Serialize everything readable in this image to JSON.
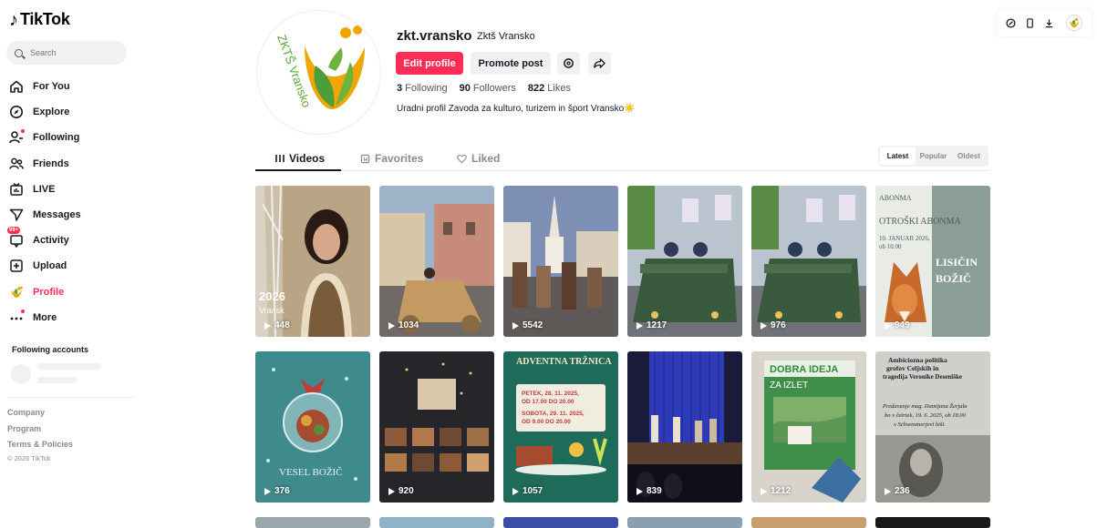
{
  "app": {
    "logo_text": "TikTok"
  },
  "search": {
    "placeholder": "Search"
  },
  "nav": [
    {
      "label": "For You",
      "icon": "home-icon"
    },
    {
      "label": "Explore",
      "icon": "compass-icon"
    },
    {
      "label": "Following",
      "icon": "following-icon"
    },
    {
      "label": "Friends",
      "icon": "friends-icon"
    },
    {
      "label": "LIVE",
      "icon": "live-icon"
    },
    {
      "label": "Messages",
      "icon": "messages-icon"
    },
    {
      "label": "Activity",
      "icon": "activity-icon",
      "badge": "99+"
    },
    {
      "label": "Upload",
      "icon": "upload-icon"
    },
    {
      "label": "Profile",
      "icon": "profile-icon",
      "active": true
    },
    {
      "label": "More",
      "icon": "more-icon"
    }
  ],
  "following_accounts": {
    "title": "Following accounts"
  },
  "footer": {
    "company": "Company",
    "program": "Program",
    "terms": "Terms & Policies",
    "copyright": "© 2026 TikTok"
  },
  "profile": {
    "username": "zkt.vransko",
    "nickname": "Zktš Vransko",
    "avatar_text": "ZKTŠ Vransko",
    "edit_label": "Edit profile",
    "promote_label": "Promote post",
    "stats": {
      "following_count": "3",
      "following_label": "Following",
      "followers_count": "90",
      "followers_label": "Followers",
      "likes_count": "822",
      "likes_label": "Likes"
    },
    "bio": "Uradni profil Zavoda za kulturo, turizem in šport Vransko☀️"
  },
  "tabs": {
    "videos": "Videos",
    "favorites": "Favorites",
    "liked": "Liked"
  },
  "sort": {
    "latest": "Latest",
    "popular": "Popular",
    "oldest": "Oldest"
  },
  "videos": [
    {
      "views": "448",
      "theme": "woman-speaking",
      "overlay": "2026\nVransk"
    },
    {
      "views": "1034",
      "theme": "wooden-car-street"
    },
    {
      "views": "5542",
      "theme": "krampus-parade"
    },
    {
      "views": "1217",
      "theme": "green-tank"
    },
    {
      "views": "976",
      "theme": "green-tank"
    },
    {
      "views": "949",
      "theme": "poster-fox",
      "overlay": "ABONMA\nOTROŠKI ABONMA\n10. JANUAR 2026, ob 10.00\nLISIČIN BOŽIČ"
    },
    {
      "views": "376",
      "theme": "christmas-ornament",
      "overlay": "VESEL BOŽIČ"
    },
    {
      "views": "920",
      "theme": "dark-poster"
    },
    {
      "views": "1057",
      "theme": "advent-poster",
      "overlay": "ADVENTNA TRŽNICA\nPETEK, 28. 11. 2025, OD 17.00 DO 20.00\nSOBOTA, 29. 11. 2025, OD 9.00 DO 20.00"
    },
    {
      "views": "839",
      "theme": "concert-stage"
    },
    {
      "views": "1212",
      "theme": "dobra-ideja",
      "overlay": "DOBRA IDEJA\nZA IZLET"
    },
    {
      "views": "236",
      "theme": "lecture-poster",
      "overlay": "Ambiciozna politika grofov Celjskih in tragedija Veronike Deseniške\nPredavanje mag. Damijana Žerjala bo v četrtek, 19. 6. 2025, ob 18.00 v Schwentnerjevi hiši."
    }
  ],
  "colors": {
    "accent": "#fe2c55",
    "text": "#161823",
    "muted": "#8a8b91",
    "chip": "#f1f1f2"
  }
}
